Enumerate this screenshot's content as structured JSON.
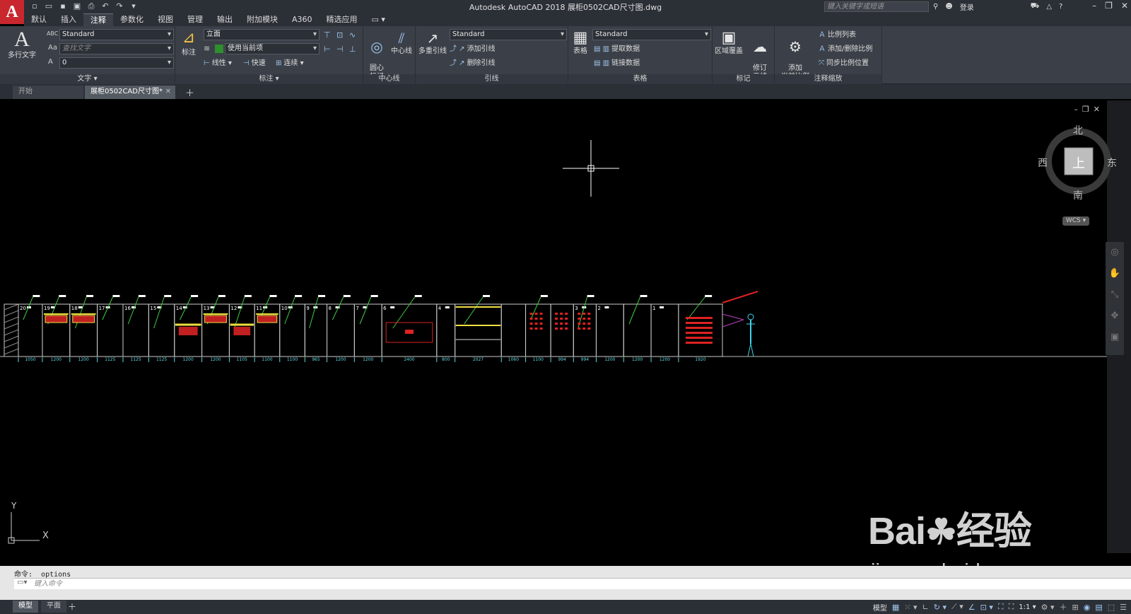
{
  "app": {
    "logo": "A",
    "window_title": "Autodesk AutoCAD 2018    展柜0502CAD尺寸图.dwg",
    "search_placeholder": "键入关键字或短语",
    "login_label": "登录",
    "quick_access": [
      "new-icon",
      "open-icon",
      "save-icon",
      "saveas-icon",
      "print-icon",
      "undo-icon",
      "redo-icon",
      "dropdown-icon"
    ]
  },
  "ribbon_tabs": [
    "默认",
    "插入",
    "注释",
    "参数化",
    "视图",
    "管理",
    "输出",
    "附加模块",
    "A360",
    "精选应用"
  ],
  "ribbon_active_tab": "注释",
  "ribbon": {
    "text_panel": {
      "title": "文字 ▾",
      "multiline_text": "多行文字",
      "style_value": "Standard",
      "find_placeholder": "查找文字",
      "height_value": "0"
    },
    "dim_panel": {
      "title": "标注 ▾",
      "dim_button": "标注",
      "layer_value": "立面",
      "use_current": "使用当前项",
      "linear": "线性",
      "quick": "快速",
      "continue": "连续"
    },
    "center_panel": {
      "title": "中心线",
      "center_mark": "圆心\n标记",
      "centerline": "中心线"
    },
    "leader_panel": {
      "title": "引线",
      "multileader": "多重引线",
      "style_value": "Standard",
      "add_leader": "添加引线",
      "remove_leader": "删除引线"
    },
    "table_panel": {
      "title": "表格",
      "table": "表格",
      "style_value": "Standard",
      "extract_data": "提取数据",
      "link_data": "链接数据"
    },
    "markup_panel": {
      "title": "标记",
      "wipeout": "区域覆盖",
      "revcloud": "修订\n云线"
    },
    "scale_panel": {
      "title": "注释缩放",
      "add_current_scale": "添加\n当前比例",
      "scale_list": "比例列表",
      "add_delete_scale": "添加/删除比例",
      "sync_scale": "同步比例位置"
    }
  },
  "doc_tabs": [
    {
      "label": "开始",
      "active": false
    },
    {
      "label": "展柜0502CAD尺寸图*",
      "active": true
    }
  ],
  "viewcube": {
    "north": "北",
    "south": "南",
    "west": "西",
    "east": "东",
    "face": "上",
    "wcs": "WCS ▾"
  },
  "ucs": {
    "x": "X",
    "y": "Y"
  },
  "drawing": {
    "bays": [
      {
        "n": "20",
        "dim": "1050"
      },
      {
        "n": "19",
        "dim": "1200"
      },
      {
        "n": "18",
        "dim": "1200"
      },
      {
        "n": "17",
        "dim": "1125"
      },
      {
        "n": "16",
        "dim": "1125"
      },
      {
        "n": "15",
        "dim": "1125"
      },
      {
        "n": "14",
        "dim": "1200"
      },
      {
        "n": "13",
        "dim": "1200"
      },
      {
        "n": "12",
        "dim": "1105"
      },
      {
        "n": "11",
        "dim": "1100"
      },
      {
        "n": "10",
        "dim": "1100"
      },
      {
        "n": "9",
        "dim": "965"
      },
      {
        "n": "8",
        "dim": "1200"
      },
      {
        "n": "7",
        "dim": "1200"
      },
      {
        "n": "6",
        "dim": "2400"
      },
      {
        "n": "4",
        "dim": "800"
      },
      {
        "n": "",
        "dim": "2027"
      },
      {
        "n": "",
        "dim": "1060"
      },
      {
        "n": "",
        "dim": "1100"
      },
      {
        "n": "",
        "dim": "994"
      },
      {
        "n": "3",
        "dim": "994"
      },
      {
        "n": "2",
        "dim": "1200"
      },
      {
        "n": "",
        "dim": "1200"
      },
      {
        "n": "1",
        "dim": "1200"
      },
      {
        "n": "",
        "dim": "1920"
      }
    ]
  },
  "command": {
    "history": "命令: _options",
    "input_placeholder": "键入命令"
  },
  "layout_tabs": [
    "模型",
    "平面"
  ],
  "status": {
    "model_label": "模型",
    "scale_label": "1:1 ▾"
  },
  "watermark": {
    "brand": "Bai",
    "brand_suffix": "经验",
    "url": "jingyan.baidu.com"
  }
}
